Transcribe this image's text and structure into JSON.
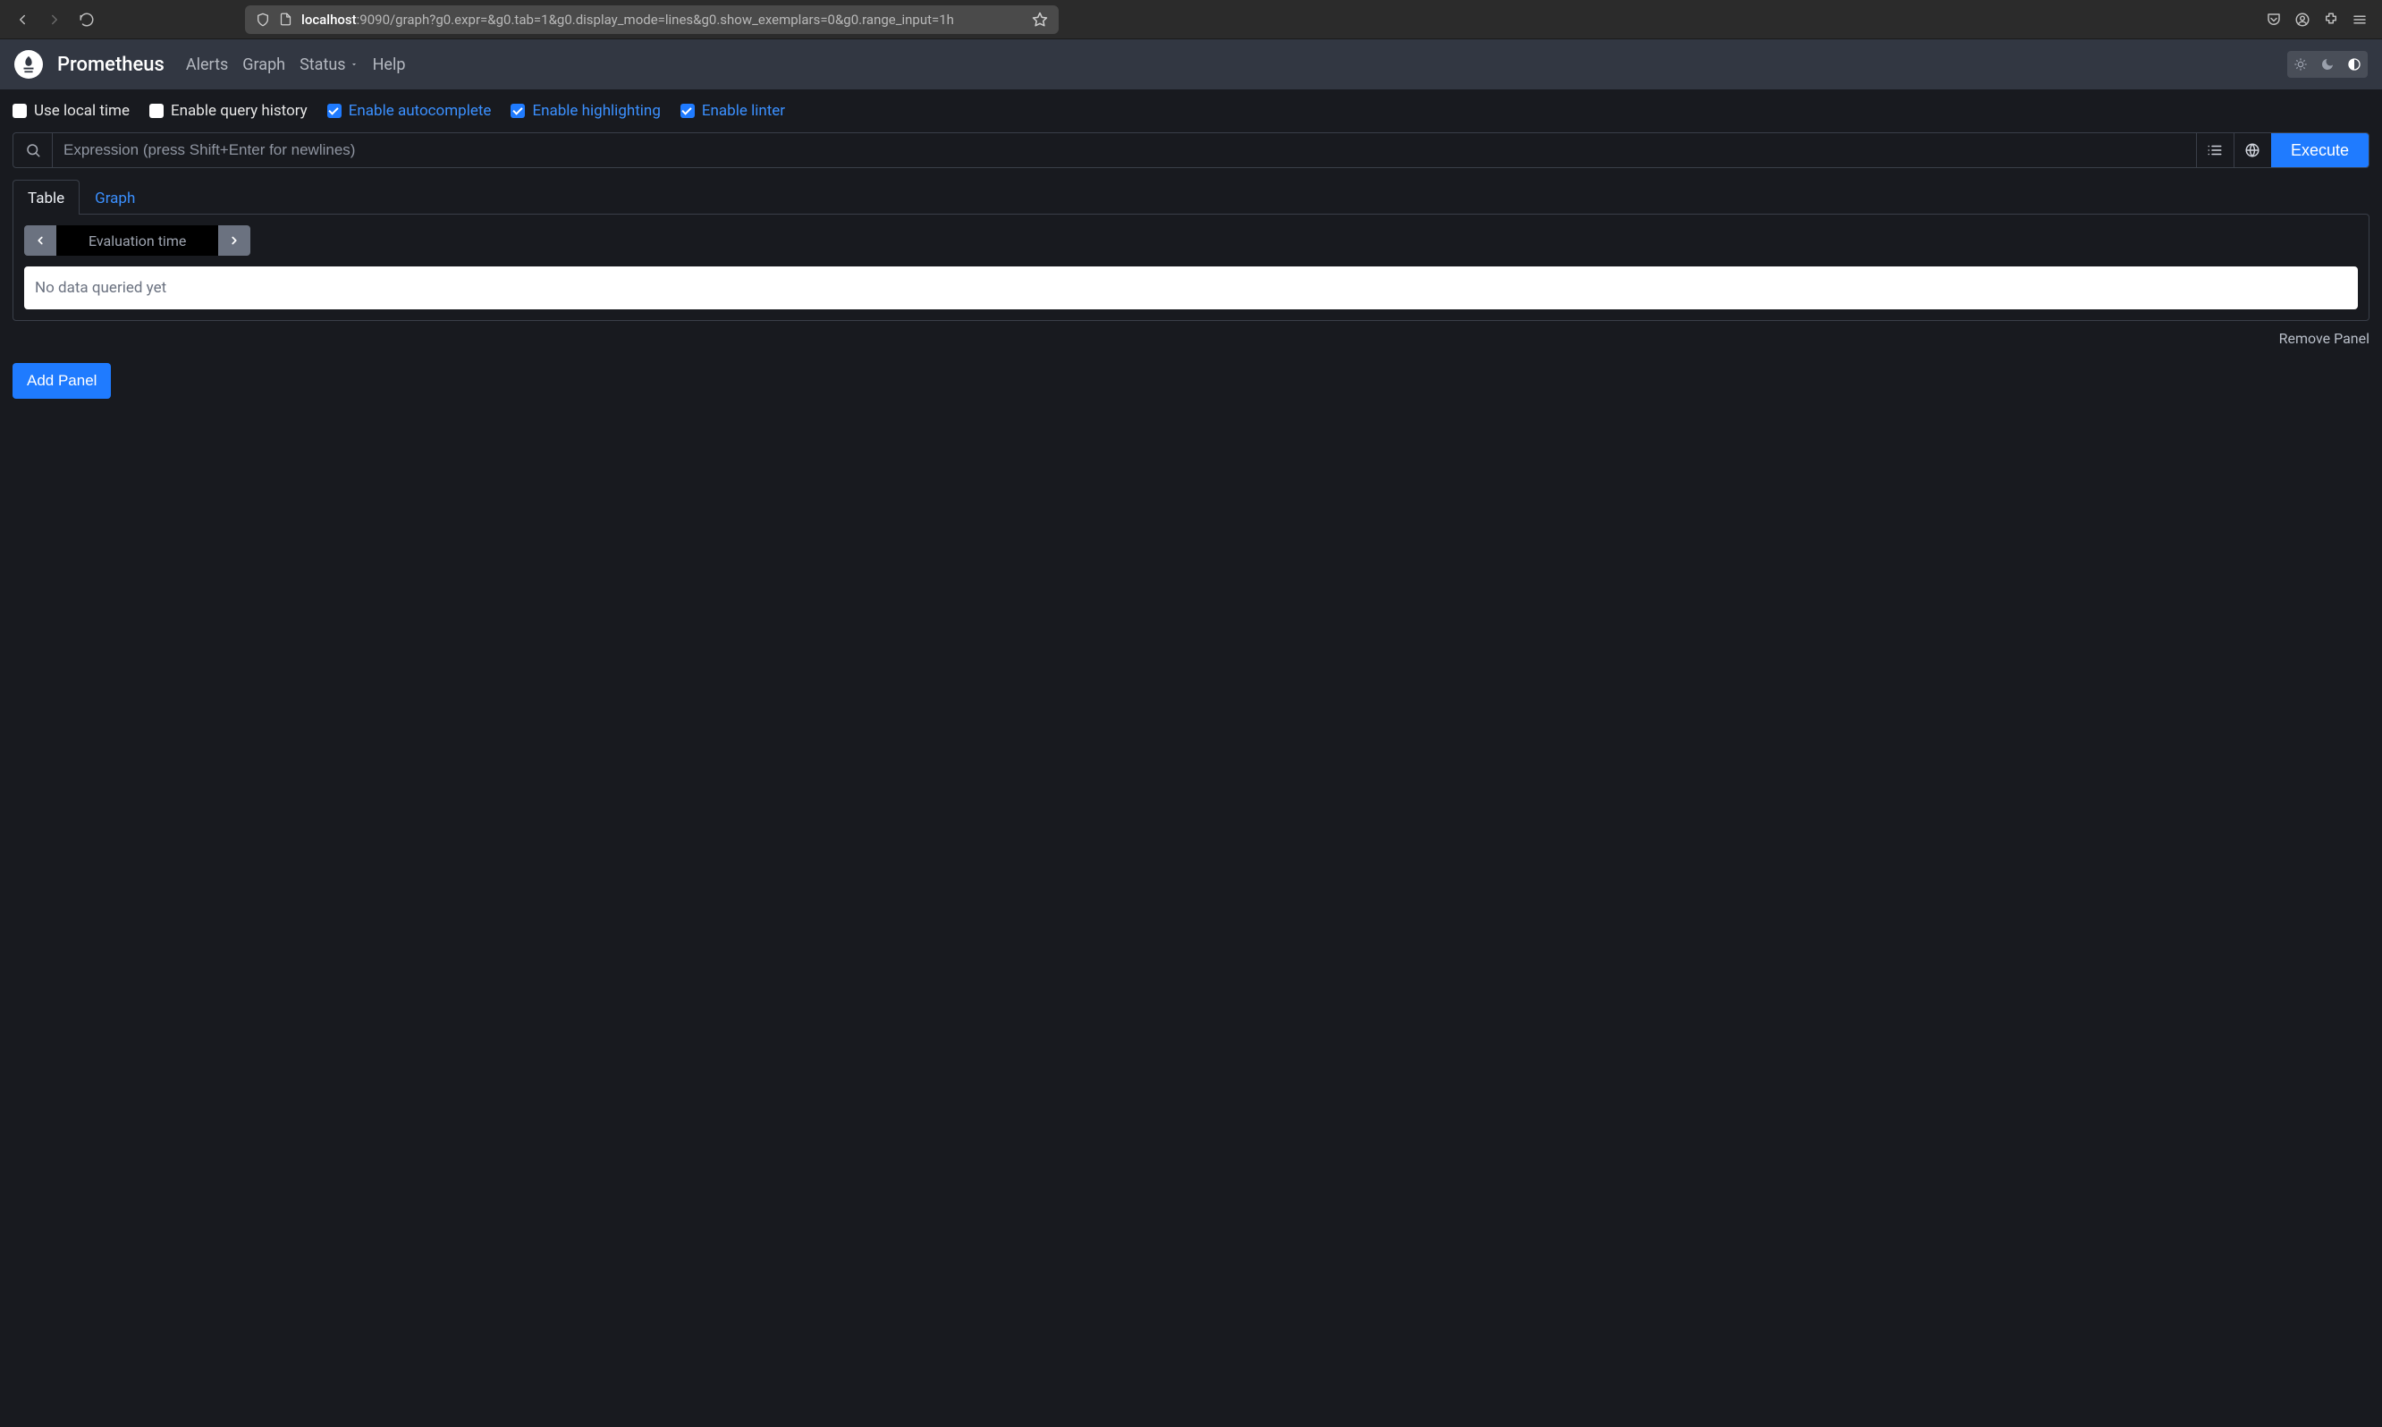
{
  "browser": {
    "url_host": "localhost",
    "url_rest": ":9090/graph?g0.expr=&g0.tab=1&g0.display_mode=lines&g0.show_exemplars=0&g0.range_input=1h"
  },
  "navbar": {
    "brand": "Prometheus",
    "links": {
      "alerts": "Alerts",
      "graph": "Graph",
      "status": "Status",
      "help": "Help"
    }
  },
  "options": {
    "use_local_time": {
      "label": "Use local time",
      "checked": false
    },
    "enable_query_history": {
      "label": "Enable query history",
      "checked": false
    },
    "enable_autocomplete": {
      "label": "Enable autocomplete",
      "checked": true
    },
    "enable_highlighting": {
      "label": "Enable highlighting",
      "checked": true
    },
    "enable_linter": {
      "label": "Enable linter",
      "checked": true
    }
  },
  "expression": {
    "placeholder": "Expression (press Shift+Enter for newlines)",
    "value": "",
    "execute_label": "Execute"
  },
  "tabs": {
    "table": "Table",
    "graph": "Graph"
  },
  "panel": {
    "eval_time_label": "Evaluation time",
    "result_text": "No data queried yet",
    "remove_label": "Remove Panel"
  },
  "add_panel_label": "Add Panel"
}
